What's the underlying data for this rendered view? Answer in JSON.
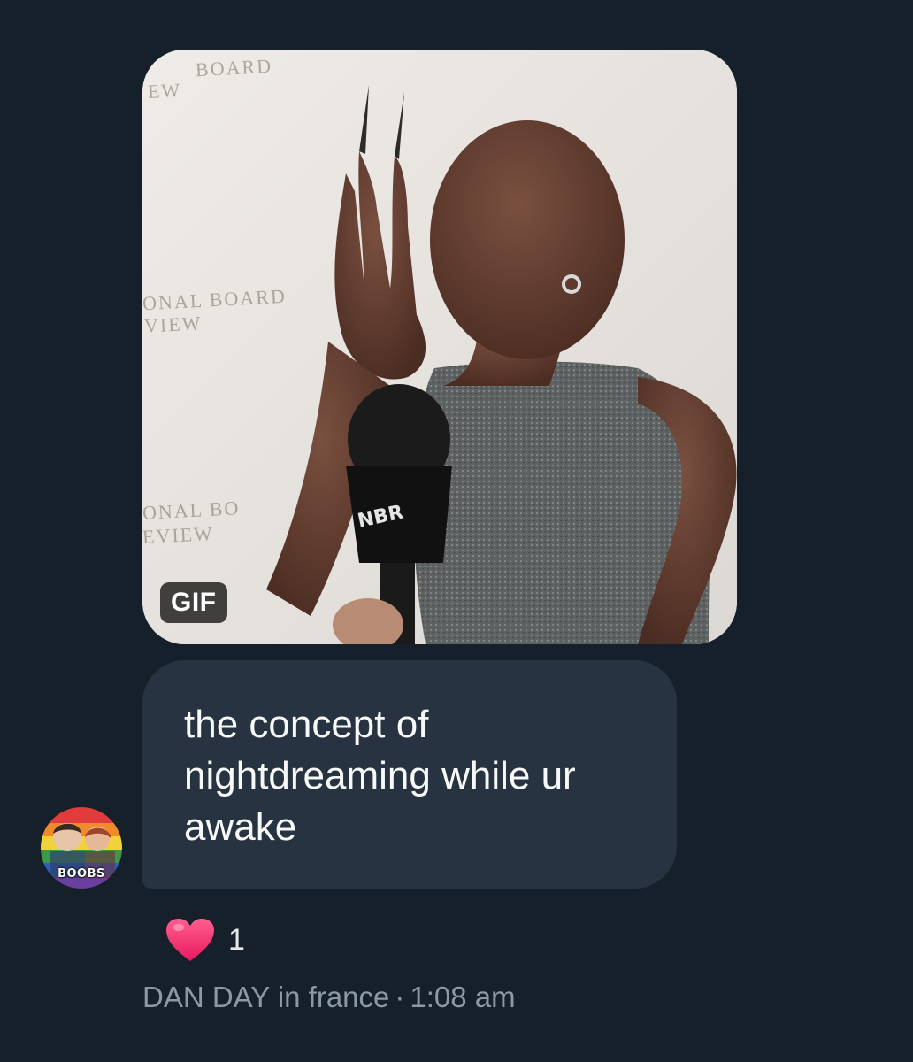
{
  "media": {
    "type_badge": "GIF",
    "backdrop_texts": [
      "BOARD",
      "EW",
      "ONAL BOARD",
      "VIEW",
      "ONAL BO",
      "EVIEW"
    ],
    "mic_letters": "NBR"
  },
  "message": {
    "text": "the concept of nightdreaming while ur awake"
  },
  "sender": {
    "avatar_label": "BOOBS"
  },
  "reaction": {
    "emoji_name": "heart-icon",
    "count": "1",
    "color": "#f91880"
  },
  "meta": {
    "sender_name": "DAN DAY in france",
    "separator": "·",
    "time": "1:08 am"
  },
  "colors": {
    "background": "#15202b",
    "bubble": "#273340",
    "text": "#f7f9f9",
    "muted": "#8b98a5"
  }
}
